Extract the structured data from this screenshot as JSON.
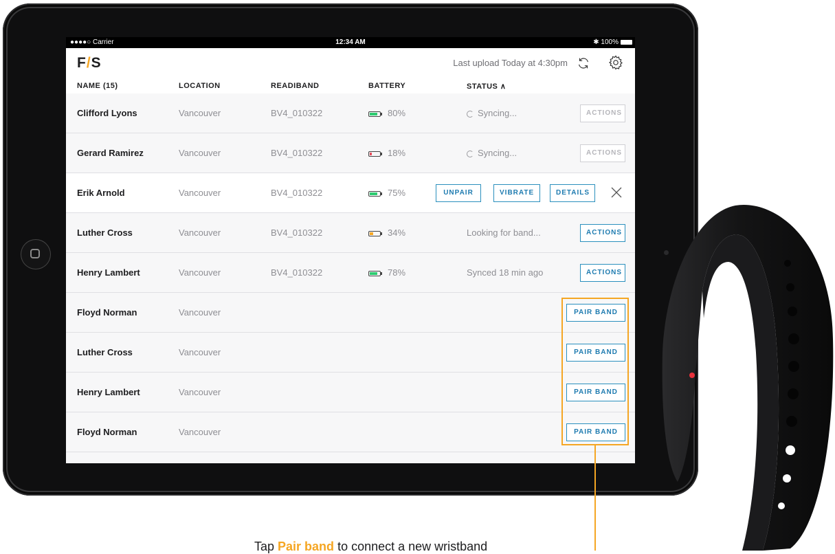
{
  "status_bar": {
    "carrier": "●●●●○ Carrier",
    "time": "12:34 AM",
    "battery": "✱ 100%"
  },
  "header": {
    "logo_left": "F",
    "logo_slash": "/",
    "logo_right": "S",
    "last_upload": "Last upload Today at 4:30pm"
  },
  "columns": {
    "name": "NAME (15)",
    "location": "LOCATION",
    "readiband": "READIBAND",
    "battery": "BATTERY",
    "status": "STATUS ∧"
  },
  "rows": [
    {
      "name": "Clifford Lyons",
      "location": "Vancouver",
      "band": "BV4_010322",
      "battery": "80%",
      "battery_level": 0.8,
      "battery_color": "#2ecc71",
      "status": "Syncing...",
      "action": "ACTIONS"
    },
    {
      "name": "Gerard Ramirez",
      "location": "Vancouver",
      "band": "BV4_010322",
      "battery": "18%",
      "battery_level": 0.18,
      "battery_color": "#e74c5b",
      "status": "Syncing...",
      "action": "ACTIONS"
    },
    {
      "name": "Erik Arnold",
      "location": "Vancouver",
      "band": "BV4_010322",
      "battery": "75%",
      "battery_level": 0.75,
      "battery_color": "#2ecc71",
      "unpair": "UNPAIR",
      "vibrate": "VIBRATE",
      "details": "DETAILS"
    },
    {
      "name": "Luther Cross",
      "location": "Vancouver",
      "band": "BV4_010322",
      "battery": "34%",
      "battery_level": 0.34,
      "battery_color": "#f5a623",
      "status": "Looking for band...",
      "action": "ACTIONS"
    },
    {
      "name": "Henry Lambert",
      "location": "Vancouver",
      "band": "BV4_010322",
      "battery": "78%",
      "battery_level": 0.78,
      "battery_color": "#2ecc71",
      "status": "Synced 18 min ago",
      "action": "ACTIONS"
    },
    {
      "name": "Floyd Norman",
      "location": "Vancouver",
      "action": "PAIR BAND"
    },
    {
      "name": "Luther Cross",
      "location": "Vancouver",
      "action": "PAIR BAND"
    },
    {
      "name": "Henry Lambert",
      "location": "Vancouver",
      "action": "PAIR BAND"
    },
    {
      "name": "Floyd Norman",
      "location": "Vancouver",
      "action": "PAIR BAND"
    }
  ],
  "caption": {
    "prefix": "Tap ",
    "highlight": "Pair band",
    "suffix": " to connect a new wristband"
  },
  "colors": {
    "accent": "#f5a623",
    "link_blue": "#1e7bb0"
  }
}
